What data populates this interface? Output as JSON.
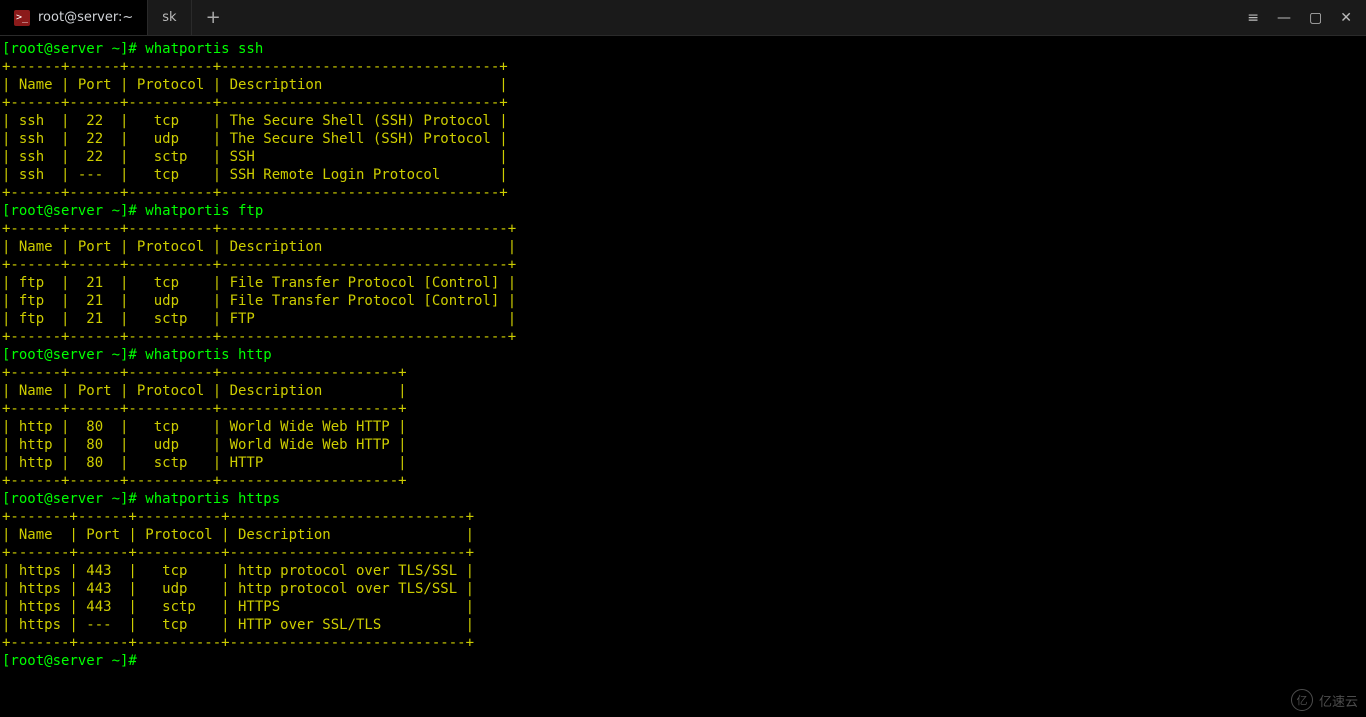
{
  "titlebar": {
    "tabs": [
      {
        "label": "root@server:~",
        "active": true,
        "icon": ">_"
      },
      {
        "label": "sk",
        "active": false
      }
    ],
    "new_tab": "+"
  },
  "prompt_host": "[root@server ~]#",
  "commands": [
    {
      "cmd": "whatportis ssh",
      "cols": [
        "Name",
        "Port",
        "Protocol",
        "Description"
      ],
      "widths": [
        6,
        6,
        10,
        33
      ],
      "rows": [
        [
          "ssh",
          "22",
          "tcp",
          "The Secure Shell (SSH) Protocol"
        ],
        [
          "ssh",
          "22",
          "udp",
          "The Secure Shell (SSH) Protocol"
        ],
        [
          "ssh",
          "22",
          "sctp",
          "SSH"
        ],
        [
          "ssh",
          "---",
          "tcp",
          "SSH Remote Login Protocol"
        ]
      ]
    },
    {
      "cmd": "whatportis ftp",
      "cols": [
        "Name",
        "Port",
        "Protocol",
        "Description"
      ],
      "widths": [
        6,
        6,
        10,
        34
      ],
      "rows": [
        [
          "ftp",
          "21",
          "tcp",
          "File Transfer Protocol [Control]"
        ],
        [
          "ftp",
          "21",
          "udp",
          "File Transfer Protocol [Control]"
        ],
        [
          "ftp",
          "21",
          "sctp",
          "FTP"
        ]
      ]
    },
    {
      "cmd": "whatportis http",
      "cols": [
        "Name",
        "Port",
        "Protocol",
        "Description"
      ],
      "widths": [
        6,
        6,
        10,
        21
      ],
      "rows": [
        [
          "http",
          "80",
          "tcp",
          "World Wide Web HTTP"
        ],
        [
          "http",
          "80",
          "udp",
          "World Wide Web HTTP"
        ],
        [
          "http",
          "80",
          "sctp",
          "HTTP"
        ]
      ]
    },
    {
      "cmd": "whatportis https",
      "cols": [
        "Name",
        "Port",
        "Protocol",
        "Description"
      ],
      "widths": [
        7,
        6,
        10,
        28
      ],
      "rows": [
        [
          "https",
          "443",
          "tcp",
          "http protocol over TLS/SSL"
        ],
        [
          "https",
          "443",
          "udp",
          "http protocol over TLS/SSL"
        ],
        [
          "https",
          "443",
          "sctp",
          "HTTPS"
        ],
        [
          "https",
          "---",
          "tcp",
          "HTTP over SSL/TLS"
        ]
      ]
    }
  ],
  "trailing_prompt": "[root@server ~]#",
  "watermark": "亿速云"
}
